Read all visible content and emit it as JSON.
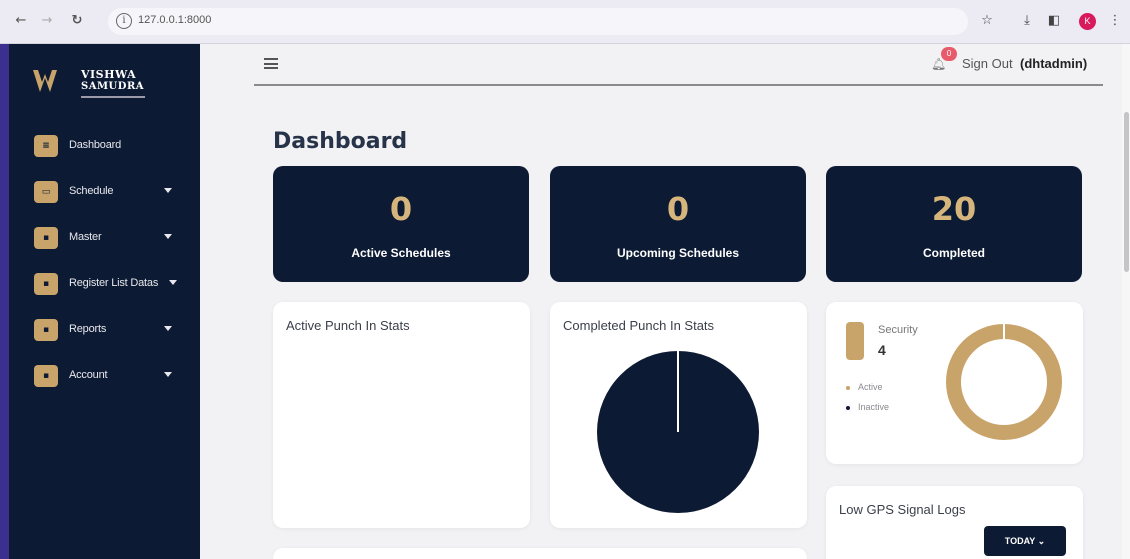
{
  "browser": {
    "url": "127.0.0.1:8000",
    "profile_initial": "K"
  },
  "sidebar": {
    "brand_line1": "VISHWA",
    "brand_line2": "SAMUDRA",
    "items": [
      {
        "label": "Dashboard",
        "icon": "dashboard-icon",
        "has_caret": false
      },
      {
        "label": "Schedule",
        "icon": "schedule-icon",
        "has_caret": true
      },
      {
        "label": "Master",
        "icon": "master-icon",
        "has_caret": true
      },
      {
        "label": "Register List Datas",
        "icon": "register-icon",
        "has_caret": true
      },
      {
        "label": "Reports",
        "icon": "reports-icon",
        "has_caret": true
      },
      {
        "label": "Account",
        "icon": "account-icon",
        "has_caret": true
      }
    ]
  },
  "header": {
    "notification_count": "0",
    "sign_out_label": "Sign Out",
    "username": "(dhtadmin)"
  },
  "page_title": "Dashboard",
  "stats": [
    {
      "value": "0",
      "label": "Active Schedules"
    },
    {
      "value": "0",
      "label": "Upcoming Schedules"
    },
    {
      "value": "20",
      "label": "Completed"
    }
  ],
  "panels": {
    "active_punch": {
      "title": "Active Punch In Stats"
    },
    "completed_punch": {
      "title": "Completed Punch In Stats"
    },
    "security": {
      "label": "Security",
      "count": "4",
      "legend": [
        {
          "label": "Active",
          "color": "#c9a46a"
        },
        {
          "label": "Inactive",
          "color": "#0c1a33"
        }
      ]
    },
    "low_gps": {
      "title": "Low GPS Signal Logs",
      "filter_label": "TODAY ⌄"
    }
  },
  "chart_data": [
    {
      "type": "pie",
      "title": "Completed Punch In Stats",
      "slices": [
        {
          "value": 20,
          "color": "#0c1a33"
        }
      ]
    },
    {
      "type": "pie",
      "title": "Security",
      "slices": [
        {
          "label": "Active",
          "value": 4,
          "color": "#c9a46a"
        },
        {
          "label": "Inactive",
          "value": 0,
          "color": "#0c1a33"
        }
      ]
    }
  ],
  "colors": {
    "navy": "#0c1a33",
    "gold": "#c9a46a",
    "stat_value": "#d6b57d"
  }
}
